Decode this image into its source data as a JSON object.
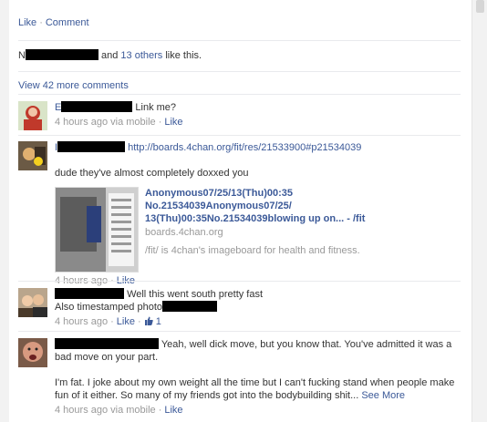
{
  "top_actions": {
    "like": "Like",
    "comment": "Comment"
  },
  "likes": {
    "rest": " and ",
    "others": "13 others",
    "tail": " like this."
  },
  "view_more": "View 42 more comments",
  "sep": "·",
  "comments": [
    {
      "text": "Link me?",
      "meta_time": "4 hours ago via mobile",
      "like": "Like"
    },
    {
      "link": "http://boards.4chan.org/fit/res/21533900#p21534039",
      "text": "dude they've almost completely doxxed you",
      "attachment": {
        "title": "Anonymous07/25/13(Thu)00:35 No.21534039Anonymous07/25/ 13(Thu)00:35No.21534039blowing up on... - /fit",
        "domain": "boards.4chan.org",
        "description": "/fit/ is 4chan's imageboard for health and fitness."
      },
      "meta_time": "4 hours ago",
      "like": "Like"
    },
    {
      "text": "Well this went south pretty fast",
      "text2": "Also timestamped photo",
      "meta_time": "4 hours ago",
      "like": "Like",
      "like_count": "1"
    },
    {
      "text": "Yeah, well dick move, but you know that. You've admitted it was a bad move on your part.",
      "text2": "I'm fat. I joke about my own weight all the time but I can't fucking stand when people make fun of it either. So many of my friends got into the bodybuilding shit...",
      "see_more": "See More",
      "meta_time": "4 hours ago via mobile",
      "like": "Like"
    }
  ],
  "colors": {
    "link": "#3b5998",
    "muted": "#999999",
    "background": "#f2f2f2",
    "panel": "#ffffff"
  }
}
